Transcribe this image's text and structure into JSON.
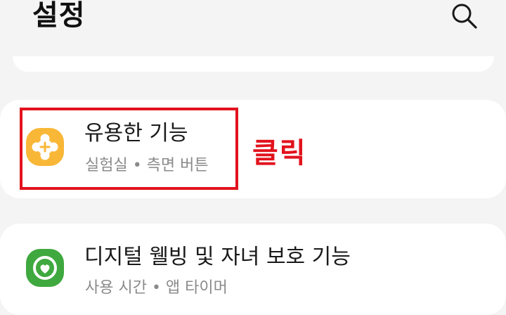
{
  "header": {
    "title": "설정",
    "search_icon": "search-icon"
  },
  "items": [
    {
      "title": "유용한 기능",
      "subtitle": "실험실 • 측면 버튼",
      "icon": "puzzle-plus-icon",
      "icon_color": "#f9b738"
    },
    {
      "title": "디지털 웰빙 및 자녀 보호 기능",
      "subtitle": "사용 시간 • 앱 타이머",
      "icon": "digital-wellbeing-icon",
      "icon_color": "#3fa83e"
    }
  ],
  "annotation": {
    "label": "클릭",
    "color": "#e2131d"
  }
}
